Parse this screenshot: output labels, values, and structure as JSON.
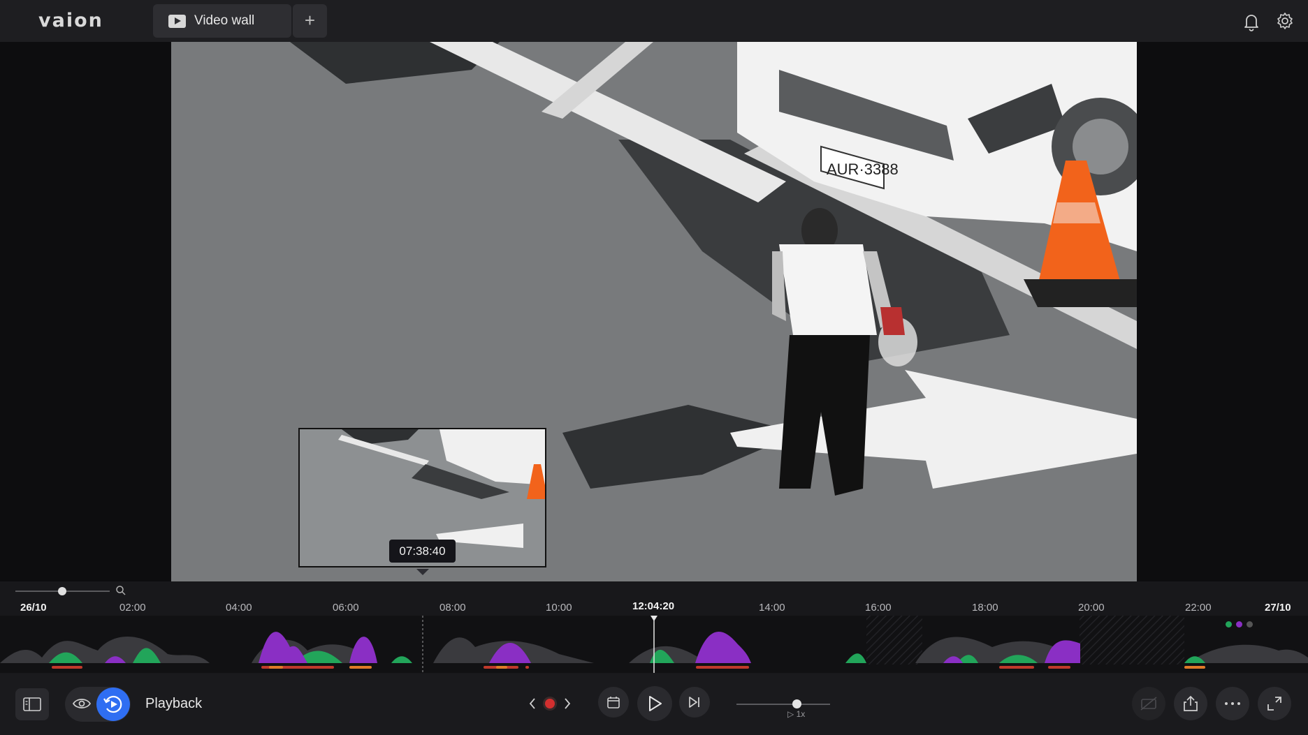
{
  "app": {
    "logo": "vaion"
  },
  "tabs": [
    {
      "label": "Video wall",
      "active": true
    }
  ],
  "add_tab_label": "+",
  "preview": {
    "time": "07:38:40"
  },
  "timeline": {
    "start_date": "26/10",
    "end_date": "27/10",
    "ticks": [
      "02:00",
      "04:00",
      "06:00",
      "08:00",
      "10:00",
      "14:00",
      "16:00",
      "18:00",
      "20:00",
      "22:00"
    ],
    "playhead_time": "12:04:20",
    "zoom_level": 0.35
  },
  "controls": {
    "mode_label": "Playback",
    "speed_label": "▷ 1x",
    "speed_value": 0.6
  },
  "colors": {
    "accent": "#2f6ef2",
    "person": "#22a55a",
    "vehicle": "#8a2fc4",
    "alarm_red": "#c0392b",
    "alarm_orange": "#e07b28",
    "cone": "#f2631b"
  },
  "icons": [
    "bell-icon",
    "gear-icon",
    "sidebar-toggle-icon",
    "eye-icon",
    "playback-icon",
    "record-icon",
    "calendar-icon",
    "play-icon",
    "skip-next-icon",
    "annotation-off-icon",
    "share-icon",
    "more-icon",
    "fullscreen-icon"
  ]
}
